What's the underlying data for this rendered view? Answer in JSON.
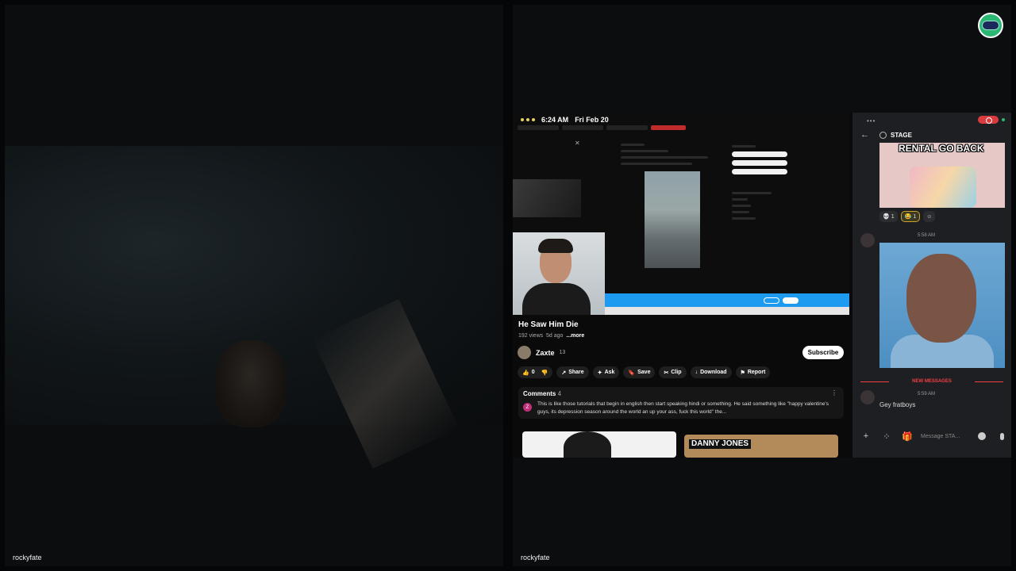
{
  "tiles": {
    "left_name": "rockyfate",
    "right_name": "rockyfate"
  },
  "ipad": {
    "time": "6:24 AM",
    "date": "Fri Feb 20"
  },
  "youtube": {
    "title": "He Saw Him Die",
    "views": "192 views",
    "age": "5d ago",
    "more": "...more",
    "channel": "Zaxte",
    "subs": "13",
    "subscribe": "Subscribe",
    "actions": [
      {
        "icon": "👍",
        "label": "0"
      },
      {
        "icon": "👎",
        "label": ""
      },
      {
        "icon": "↗",
        "label": "Share"
      },
      {
        "icon": "✦",
        "label": "Ask"
      },
      {
        "icon": "🔖",
        "label": "Save"
      },
      {
        "icon": "✂",
        "label": "Clip"
      },
      {
        "icon": "↓",
        "label": "Download"
      },
      {
        "icon": "⚑",
        "label": "Report"
      }
    ],
    "comments_label": "Comments",
    "comments_count": "4",
    "comment_avatar": "Z",
    "comment_text": "This is like those tutorials that begin in english then start speaking hindi or something. He said something like \"happy valentine's guys, its depression season around the world an up your ass, fuck this world\" the...",
    "thumb_logo": "DANNY JONES"
  },
  "discord": {
    "menu": "•••",
    "channel": "STAGE",
    "image_caption": "RENTAL GO BACK",
    "reactions": [
      {
        "icon": "💀",
        "count": "1"
      },
      {
        "icon": "😂",
        "count": "1"
      }
    ],
    "msg1_time": "5:58 AM",
    "new_messages": "NEW MESSAGES",
    "msg2_time": "5:59 AM",
    "msg2_text": "Gey fratboys",
    "input_placeholder": "Message STA..."
  }
}
